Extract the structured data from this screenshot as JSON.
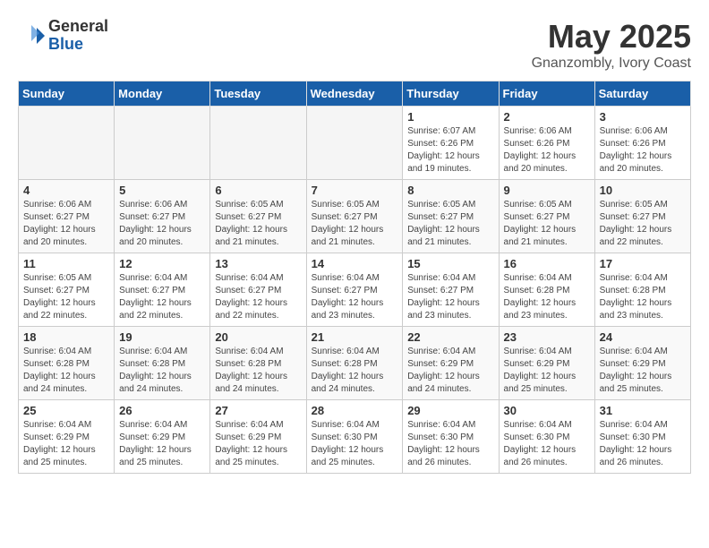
{
  "header": {
    "logo_general": "General",
    "logo_blue": "Blue",
    "month_title": "May 2025",
    "location": "Gnanzombly, Ivory Coast"
  },
  "weekdays": [
    "Sunday",
    "Monday",
    "Tuesday",
    "Wednesday",
    "Thursday",
    "Friday",
    "Saturday"
  ],
  "weeks": [
    [
      {
        "day": "",
        "info": ""
      },
      {
        "day": "",
        "info": ""
      },
      {
        "day": "",
        "info": ""
      },
      {
        "day": "",
        "info": ""
      },
      {
        "day": "1",
        "info": "Sunrise: 6:07 AM\nSunset: 6:26 PM\nDaylight: 12 hours and 19 minutes."
      },
      {
        "day": "2",
        "info": "Sunrise: 6:06 AM\nSunset: 6:26 PM\nDaylight: 12 hours and 20 minutes."
      },
      {
        "day": "3",
        "info": "Sunrise: 6:06 AM\nSunset: 6:26 PM\nDaylight: 12 hours and 20 minutes."
      }
    ],
    [
      {
        "day": "4",
        "info": "Sunrise: 6:06 AM\nSunset: 6:27 PM\nDaylight: 12 hours and 20 minutes."
      },
      {
        "day": "5",
        "info": "Sunrise: 6:06 AM\nSunset: 6:27 PM\nDaylight: 12 hours and 20 minutes."
      },
      {
        "day": "6",
        "info": "Sunrise: 6:05 AM\nSunset: 6:27 PM\nDaylight: 12 hours and 21 minutes."
      },
      {
        "day": "7",
        "info": "Sunrise: 6:05 AM\nSunset: 6:27 PM\nDaylight: 12 hours and 21 minutes."
      },
      {
        "day": "8",
        "info": "Sunrise: 6:05 AM\nSunset: 6:27 PM\nDaylight: 12 hours and 21 minutes."
      },
      {
        "day": "9",
        "info": "Sunrise: 6:05 AM\nSunset: 6:27 PM\nDaylight: 12 hours and 21 minutes."
      },
      {
        "day": "10",
        "info": "Sunrise: 6:05 AM\nSunset: 6:27 PM\nDaylight: 12 hours and 22 minutes."
      }
    ],
    [
      {
        "day": "11",
        "info": "Sunrise: 6:05 AM\nSunset: 6:27 PM\nDaylight: 12 hours and 22 minutes."
      },
      {
        "day": "12",
        "info": "Sunrise: 6:04 AM\nSunset: 6:27 PM\nDaylight: 12 hours and 22 minutes."
      },
      {
        "day": "13",
        "info": "Sunrise: 6:04 AM\nSunset: 6:27 PM\nDaylight: 12 hours and 22 minutes."
      },
      {
        "day": "14",
        "info": "Sunrise: 6:04 AM\nSunset: 6:27 PM\nDaylight: 12 hours and 23 minutes."
      },
      {
        "day": "15",
        "info": "Sunrise: 6:04 AM\nSunset: 6:27 PM\nDaylight: 12 hours and 23 minutes."
      },
      {
        "day": "16",
        "info": "Sunrise: 6:04 AM\nSunset: 6:28 PM\nDaylight: 12 hours and 23 minutes."
      },
      {
        "day": "17",
        "info": "Sunrise: 6:04 AM\nSunset: 6:28 PM\nDaylight: 12 hours and 23 minutes."
      }
    ],
    [
      {
        "day": "18",
        "info": "Sunrise: 6:04 AM\nSunset: 6:28 PM\nDaylight: 12 hours and 24 minutes."
      },
      {
        "day": "19",
        "info": "Sunrise: 6:04 AM\nSunset: 6:28 PM\nDaylight: 12 hours and 24 minutes."
      },
      {
        "day": "20",
        "info": "Sunrise: 6:04 AM\nSunset: 6:28 PM\nDaylight: 12 hours and 24 minutes."
      },
      {
        "day": "21",
        "info": "Sunrise: 6:04 AM\nSunset: 6:28 PM\nDaylight: 12 hours and 24 minutes."
      },
      {
        "day": "22",
        "info": "Sunrise: 6:04 AM\nSunset: 6:29 PM\nDaylight: 12 hours and 24 minutes."
      },
      {
        "day": "23",
        "info": "Sunrise: 6:04 AM\nSunset: 6:29 PM\nDaylight: 12 hours and 25 minutes."
      },
      {
        "day": "24",
        "info": "Sunrise: 6:04 AM\nSunset: 6:29 PM\nDaylight: 12 hours and 25 minutes."
      }
    ],
    [
      {
        "day": "25",
        "info": "Sunrise: 6:04 AM\nSunset: 6:29 PM\nDaylight: 12 hours and 25 minutes."
      },
      {
        "day": "26",
        "info": "Sunrise: 6:04 AM\nSunset: 6:29 PM\nDaylight: 12 hours and 25 minutes."
      },
      {
        "day": "27",
        "info": "Sunrise: 6:04 AM\nSunset: 6:29 PM\nDaylight: 12 hours and 25 minutes."
      },
      {
        "day": "28",
        "info": "Sunrise: 6:04 AM\nSunset: 6:30 PM\nDaylight: 12 hours and 25 minutes."
      },
      {
        "day": "29",
        "info": "Sunrise: 6:04 AM\nSunset: 6:30 PM\nDaylight: 12 hours and 26 minutes."
      },
      {
        "day": "30",
        "info": "Sunrise: 6:04 AM\nSunset: 6:30 PM\nDaylight: 12 hours and 26 minutes."
      },
      {
        "day": "31",
        "info": "Sunrise: 6:04 AM\nSunset: 6:30 PM\nDaylight: 12 hours and 26 minutes."
      }
    ]
  ]
}
